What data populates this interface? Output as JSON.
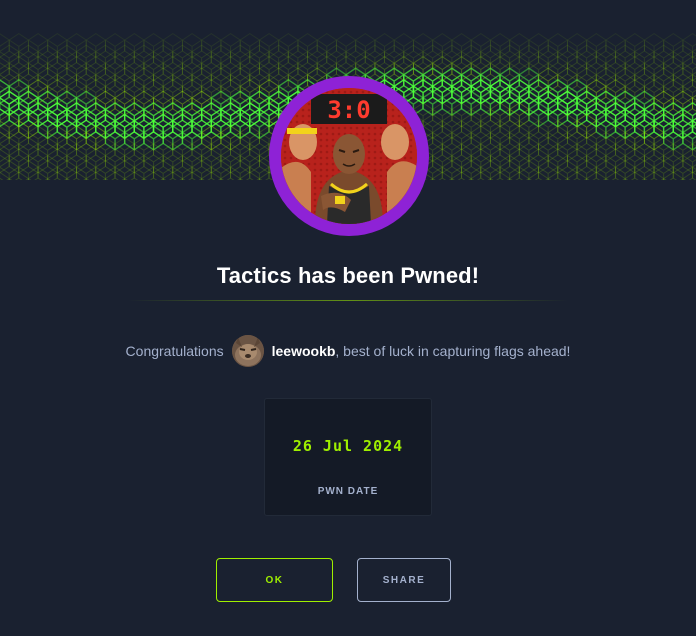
{
  "modal": {
    "title": "Tactics has been Pwned!",
    "congrats_prefix": "Congratulations",
    "username": "leewookb",
    "congrats_suffix": ", best of luck in capturing flags ahead!",
    "pwn_date": "26 Jul 2024",
    "pwn_date_label": "PWN DATE",
    "ok_label": "OK",
    "share_label": "SHARE",
    "scoreboard_digits": "3:0"
  },
  "colors": {
    "background": "#1a2130",
    "accent_green": "#9fef00",
    "avatar_ring": "#8e22d6",
    "muted_text": "#a4b1cd"
  },
  "icons": {
    "banner": "green-cube-grid-banner",
    "machine": "tactics-machine-avatar",
    "user": "user-avatar"
  }
}
